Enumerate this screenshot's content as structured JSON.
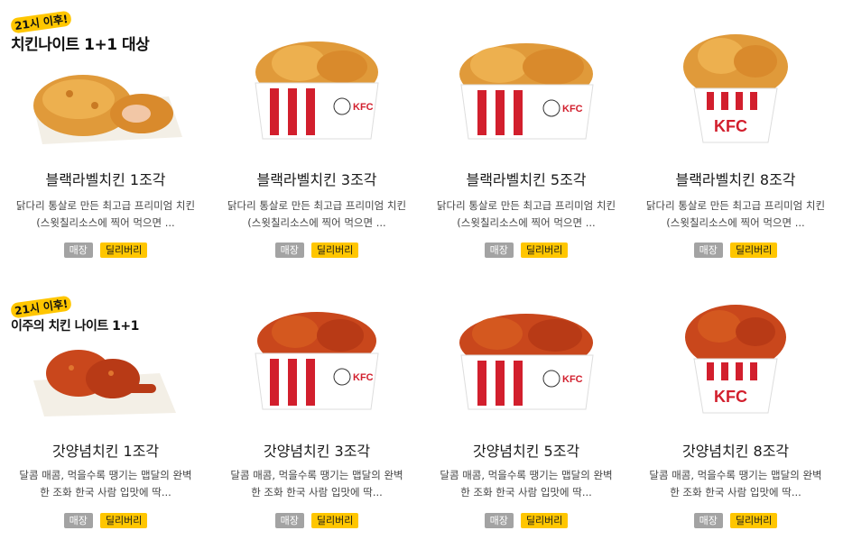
{
  "colors": {
    "kfc_red": "#d21f2d",
    "badge_yellow": "#ffc600",
    "badge_gray": "#a3a3a3",
    "chicken_crispy": "#e09a3a",
    "chicken_sauce": "#c9471c"
  },
  "promo": {
    "badge_1": "21시 이후!",
    "headline_1": "치킨나이트 1+1 대상",
    "badge_2": "21시 이후!",
    "headline_2": "이주의 치킨 나이트 1+1"
  },
  "products": [
    {
      "name": "블랙라벨치킨 1조각",
      "desc1": "닭다리 통살로 만든 최고급 프리미엄 치킨",
      "desc2": "(스윗칠리소스에 찍어 먹으면 ...",
      "store": "매장",
      "delivery": "딜리버리",
      "image": "crispy-chicken-plate-icon",
      "logo": ""
    },
    {
      "name": "블랙라벨치킨 3조각",
      "desc1": "닭다리 통살로 만든 최고급 프리미엄 치킨",
      "desc2": "(스윗칠리소스에 찍어 먹으면 ...",
      "store": "매장",
      "delivery": "딜리버리",
      "image": "crispy-chicken-box-icon",
      "logo": "KFC"
    },
    {
      "name": "블랙라벨치킨 5조각",
      "desc1": "닭다리 통살로 만든 최고급 프리미엄 치킨",
      "desc2": "(스윗칠리소스에 찍어 먹으면 ...",
      "store": "매장",
      "delivery": "딜리버리",
      "image": "crispy-chicken-box-icon",
      "logo": "KFC"
    },
    {
      "name": "블랙라벨치킨 8조각",
      "desc1": "닭다리 통살로 만든 최고급 프리미엄 치킨",
      "desc2": "(스윗칠리소스에 찍어 먹으면 ...",
      "store": "매장",
      "delivery": "딜리버리",
      "image": "crispy-chicken-bucket-icon",
      "logo": "KFC"
    },
    {
      "name": "갓양념치킨 1조각",
      "desc1": "달콤 매콤, 먹을수록 땡기는 맵달의 완벽",
      "desc2": "한 조화 한국 사람 입맛에 딱...",
      "store": "매장",
      "delivery": "딜리버리",
      "image": "sauced-chicken-plate-icon",
      "logo": ""
    },
    {
      "name": "갓양념치킨 3조각",
      "desc1": "달콤 매콤, 먹을수록 땡기는 맵달의 완벽",
      "desc2": "한 조화 한국 사람 입맛에 딱...",
      "store": "매장",
      "delivery": "딜리버리",
      "image": "sauced-chicken-box-icon",
      "logo": "KFC"
    },
    {
      "name": "갓양념치킨 5조각",
      "desc1": "달콤 매콤, 먹을수록 땡기는 맵달의 완벽",
      "desc2": "한 조화 한국 사람 입맛에 딱...",
      "store": "매장",
      "delivery": "딜리버리",
      "image": "sauced-chicken-box-icon",
      "logo": "KFC"
    },
    {
      "name": "갓양념치킨 8조각",
      "desc1": "달콤 매콤, 먹을수록 땡기는 맵달의 완벽",
      "desc2": "한 조화 한국 사람 입맛에 딱...",
      "store": "매장",
      "delivery": "딜리버리",
      "image": "sauced-chicken-bucket-icon",
      "logo": "KFC"
    }
  ]
}
